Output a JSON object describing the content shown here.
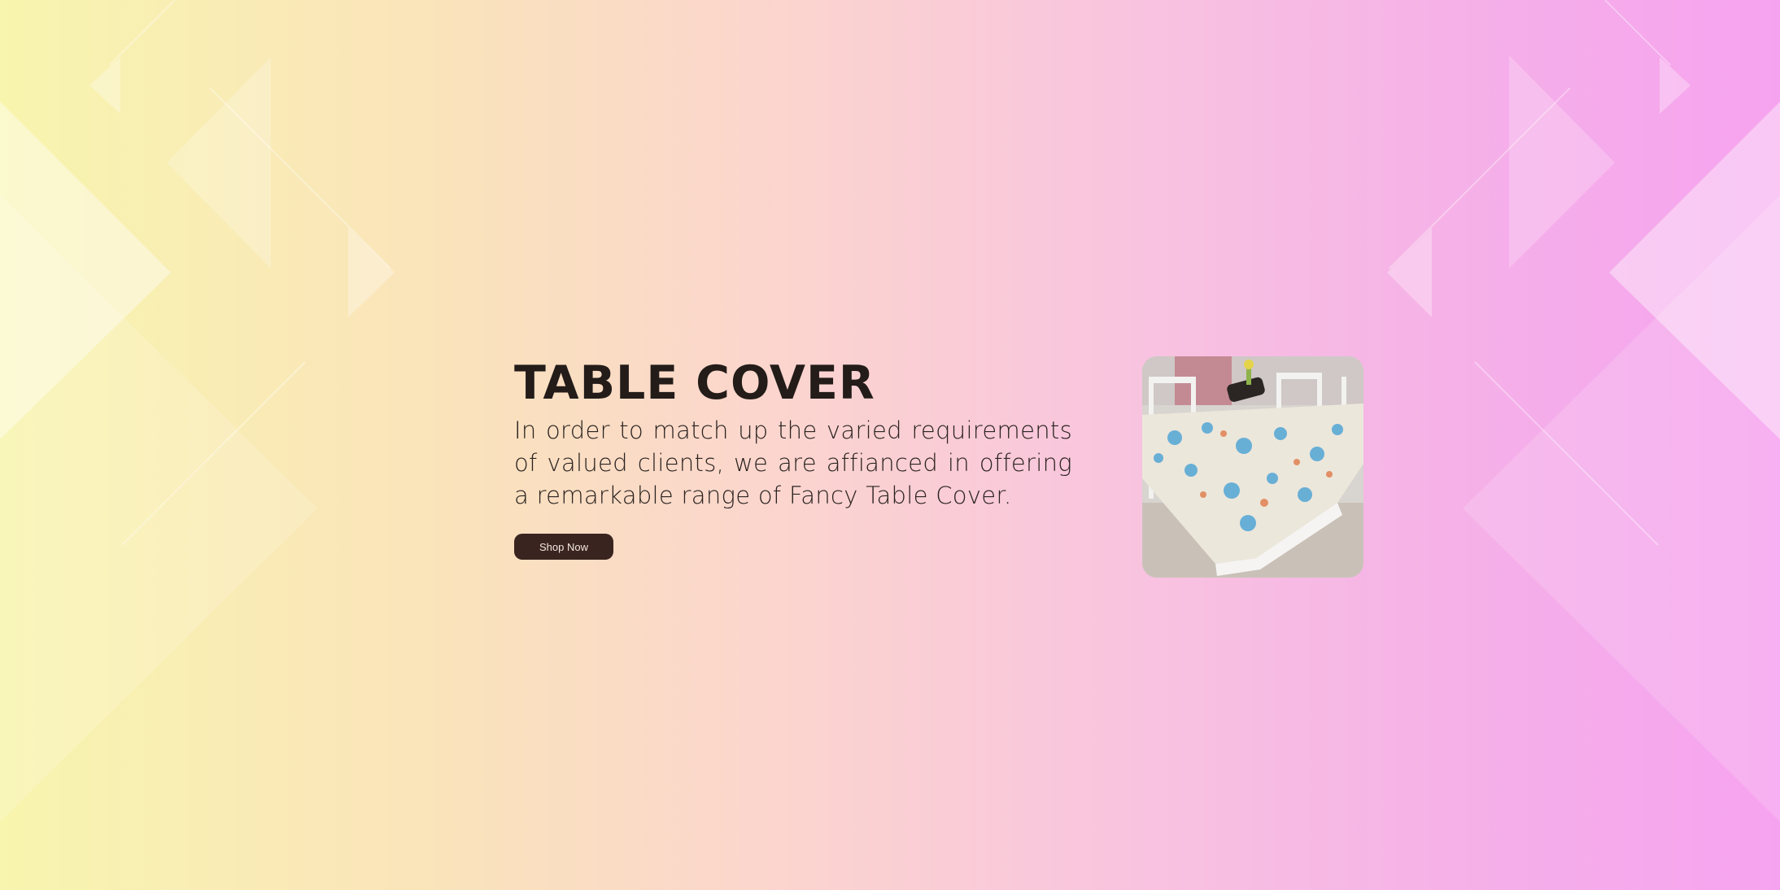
{
  "hero": {
    "title": "TABLE COVER",
    "description": "In order to match up the varied requirements of valued clients, we are affianced in offering a remarkable range of Fancy Table Cover.",
    "cta_label": "Shop Now"
  },
  "product_image": {
    "alt": "Fancy Table Cover"
  },
  "colors": {
    "gradient_left": "#f8f5ae",
    "gradient_mid": "#fbd4cf",
    "gradient_right": "#f6a3ef",
    "title_text": "#231c19",
    "button_bg": "#3a2420",
    "button_text": "#f2e6e2"
  }
}
